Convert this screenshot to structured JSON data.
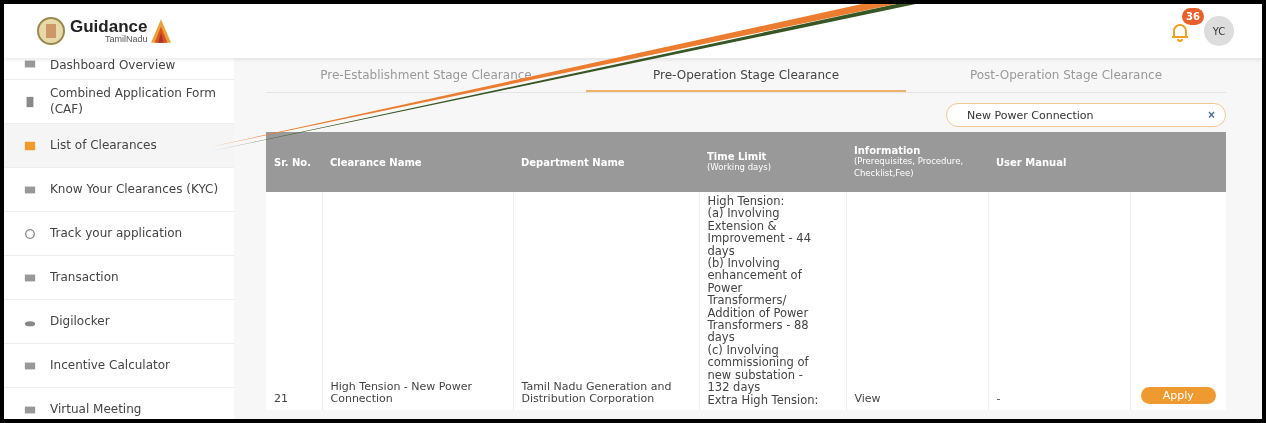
{
  "header": {
    "logo_title": "Guidance",
    "logo_subtitle": "TamilNadu",
    "notification_count": "36",
    "avatar": "YC"
  },
  "sidebar": {
    "items": [
      {
        "label": "Dashboard Overview",
        "selected": false
      },
      {
        "label": "Combined Application Form (CAF)",
        "selected": false
      },
      {
        "label": "List of Clearances",
        "selected": true
      },
      {
        "label": "Know Your Clearances (KYC)",
        "selected": false
      },
      {
        "label": "Track your application",
        "selected": false
      },
      {
        "label": "Transaction",
        "selected": false
      },
      {
        "label": "Digilocker",
        "selected": false
      },
      {
        "label": "Incentive Calculator",
        "selected": false
      },
      {
        "label": "Virtual Meeting",
        "selected": false
      }
    ]
  },
  "tabs": [
    {
      "label": "Pre-Establishment Stage Clearance",
      "selected": false
    },
    {
      "label": "Pre-Operation Stage Clearance",
      "selected": true
    },
    {
      "label": "Post-Operation Stage Clearance",
      "selected": false
    }
  ],
  "search": {
    "value": "New Power Connection",
    "clear": "×"
  },
  "table": {
    "columns": [
      {
        "title": "Sr. No."
      },
      {
        "title": "Clearance Name"
      },
      {
        "title": "Department Name"
      },
      {
        "title": "Time Limit",
        "subtitle": "(Working days)"
      },
      {
        "title": "Information",
        "subtitle": "(Prerequisites, Procedure, Checklist,Fee)"
      },
      {
        "title": "User Manual"
      }
    ],
    "rows": [
      {
        "sr_no": "21",
        "clearance_name": "High Tension - New Power Connection",
        "department": "Tamil Nadu Generation and Distribution Corporation",
        "time_limit": [
          "High Tension:",
          "(a) Involving Extension & Improvement - 44 days",
          "(b) Involving enhancement of Power Transformers/ Addition of Power Transformers - 88 days",
          "(c) Involving commissioning of new substation - 132 days",
          "Extra High Tension:"
        ],
        "information": "View",
        "user_manual": "-",
        "action": "Apply"
      }
    ]
  }
}
